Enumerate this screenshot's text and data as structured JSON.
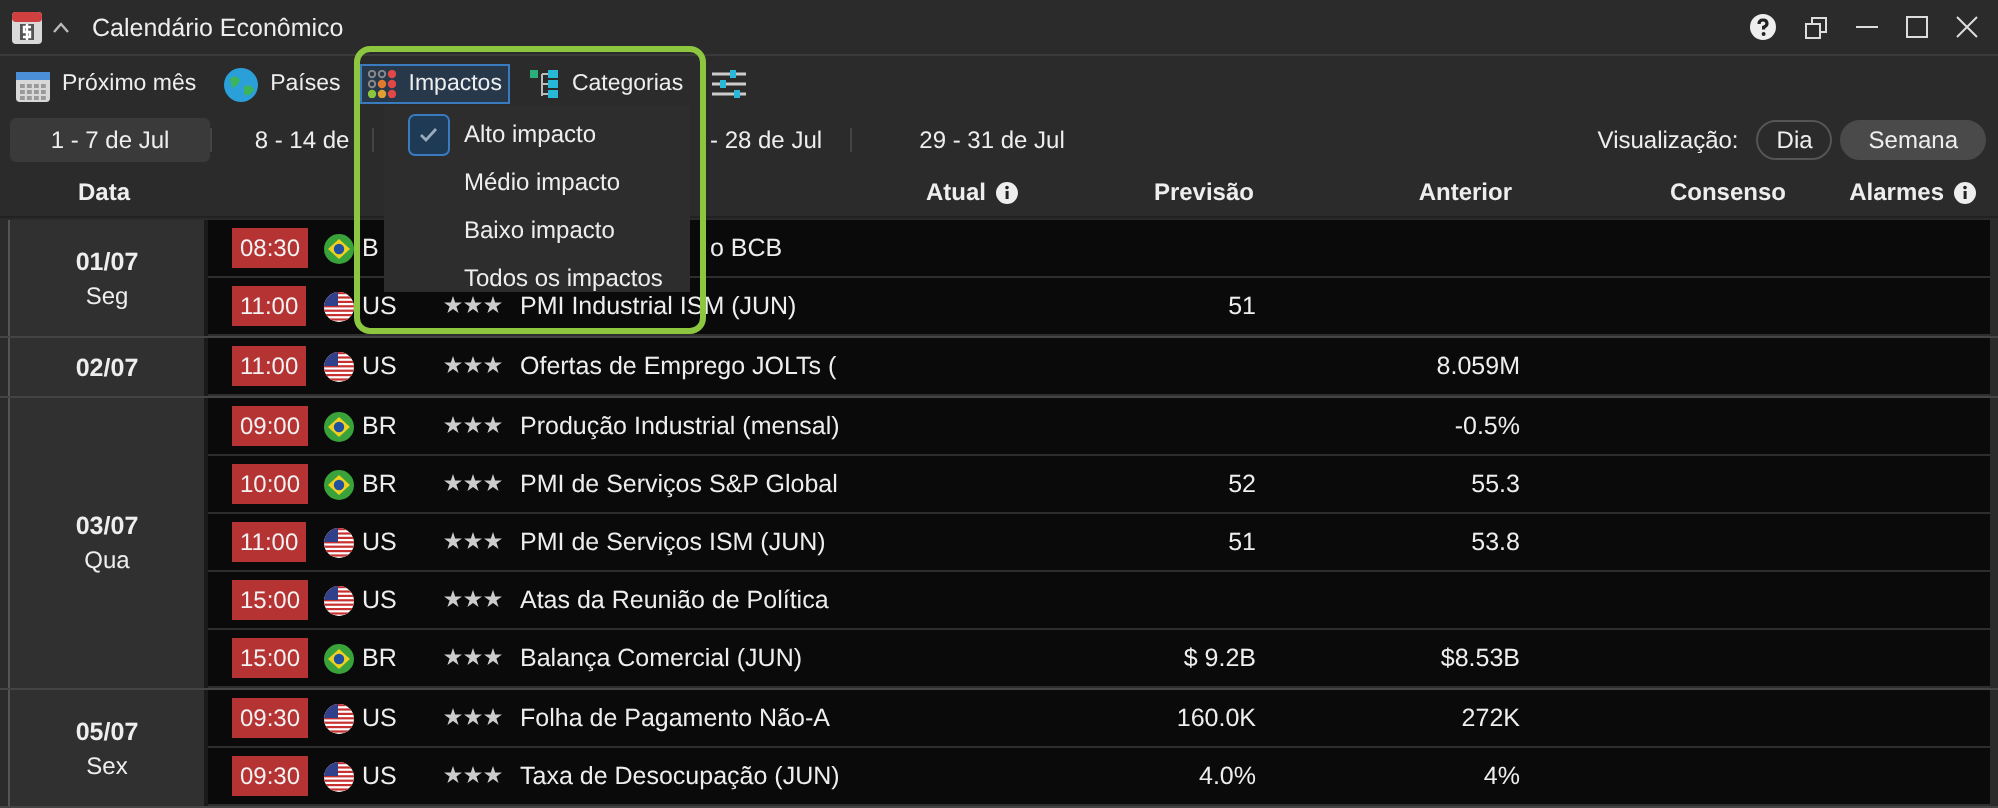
{
  "window": {
    "title": "Calendário Econômico"
  },
  "toolbar": [
    {
      "kind": "calendar",
      "label": "Próximo mês",
      "active": false
    },
    {
      "kind": "globe",
      "label": "Países",
      "active": false
    },
    {
      "kind": "dots",
      "label": "Impactos",
      "active": true
    },
    {
      "kind": "tree",
      "label": "Categorias",
      "active": false
    },
    {
      "kind": "sliders",
      "active": false
    }
  ],
  "weeks": [
    {
      "label": "1 - 7 de Jul",
      "selected": true
    },
    {
      "label": "8 - 14 de",
      "selected": false
    },
    {
      "label": "- 28 de Jul",
      "selected": false
    },
    {
      "label": "29 - 31 de Jul",
      "selected": false
    }
  ],
  "view": {
    "label": "Visualização:",
    "options": [
      {
        "label": "Dia",
        "selected": false
      },
      {
        "label": "Semana",
        "selected": true
      }
    ]
  },
  "columns": [
    {
      "label": "Data",
      "info": false
    },
    {
      "label": "Atual",
      "info": true
    },
    {
      "label": "Previsão",
      "info": false
    },
    {
      "label": "Anterior",
      "info": false
    },
    {
      "label": "Consenso",
      "info": false
    },
    {
      "label": "Alarmes",
      "info": true
    }
  ],
  "groups": [
    {
      "date": "01/07",
      "weekday": "Seg",
      "events": [
        {
          "time": "08:30",
          "kind": "br",
          "country": "B",
          "event": "o BCB"
        },
        {
          "time": "11:00",
          "kind": "us",
          "country": "US",
          "stars": 3,
          "event": "PMI Industrial ISM (JUN)",
          "forecast": "51"
        }
      ]
    },
    {
      "date": "02/07",
      "events": [
        {
          "time": "11:00",
          "kind": "us",
          "country": "US",
          "stars": 3,
          "event": "Ofertas de Emprego JOLTs (",
          "previous": "8.059M"
        }
      ]
    },
    {
      "date": "03/07",
      "weekday": "Qua",
      "events": [
        {
          "time": "09:00",
          "kind": "br",
          "country": "BR",
          "stars": 3,
          "event": "Produção Industrial (mensal)",
          "previous": "-0.5%"
        },
        {
          "time": "10:00",
          "kind": "br",
          "country": "BR",
          "stars": 3,
          "event": "PMI de Serviços S&P Global",
          "forecast": "52",
          "previous": "55.3"
        },
        {
          "time": "11:00",
          "kind": "us",
          "country": "US",
          "stars": 3,
          "event": "PMI de Serviços ISM (JUN)",
          "forecast": "51",
          "previous": "53.8"
        },
        {
          "time": "15:00",
          "kind": "us",
          "country": "US",
          "stars": 3,
          "event": "Atas da Reunião de Política"
        },
        {
          "time": "15:00",
          "kind": "br",
          "country": "BR",
          "stars": 3,
          "event": "Balança Comercial (JUN)",
          "forecast": "$ 9.2B",
          "previous": "$8.53B"
        }
      ]
    },
    {
      "date": "05/07",
      "weekday": "Sex",
      "events": [
        {
          "time": "09:30",
          "kind": "us",
          "country": "US",
          "stars": 3,
          "event": "Folha de Pagamento Não-A",
          "forecast": "160.0K",
          "previous": "272K"
        },
        {
          "time": "09:30",
          "kind": "us",
          "country": "US",
          "stars": 3,
          "event": "Taxa de Desocupação (JUN)",
          "forecast": "4.0%",
          "previous": "4%"
        }
      ]
    }
  ],
  "menu": {
    "items": [
      {
        "label": "Alto impacto",
        "checked": true
      },
      {
        "label": "Médio impacto",
        "checked": false
      },
      {
        "label": "Baixo impacto",
        "checked": false
      },
      {
        "label": "Todos os impactos",
        "checked": false
      }
    ]
  }
}
